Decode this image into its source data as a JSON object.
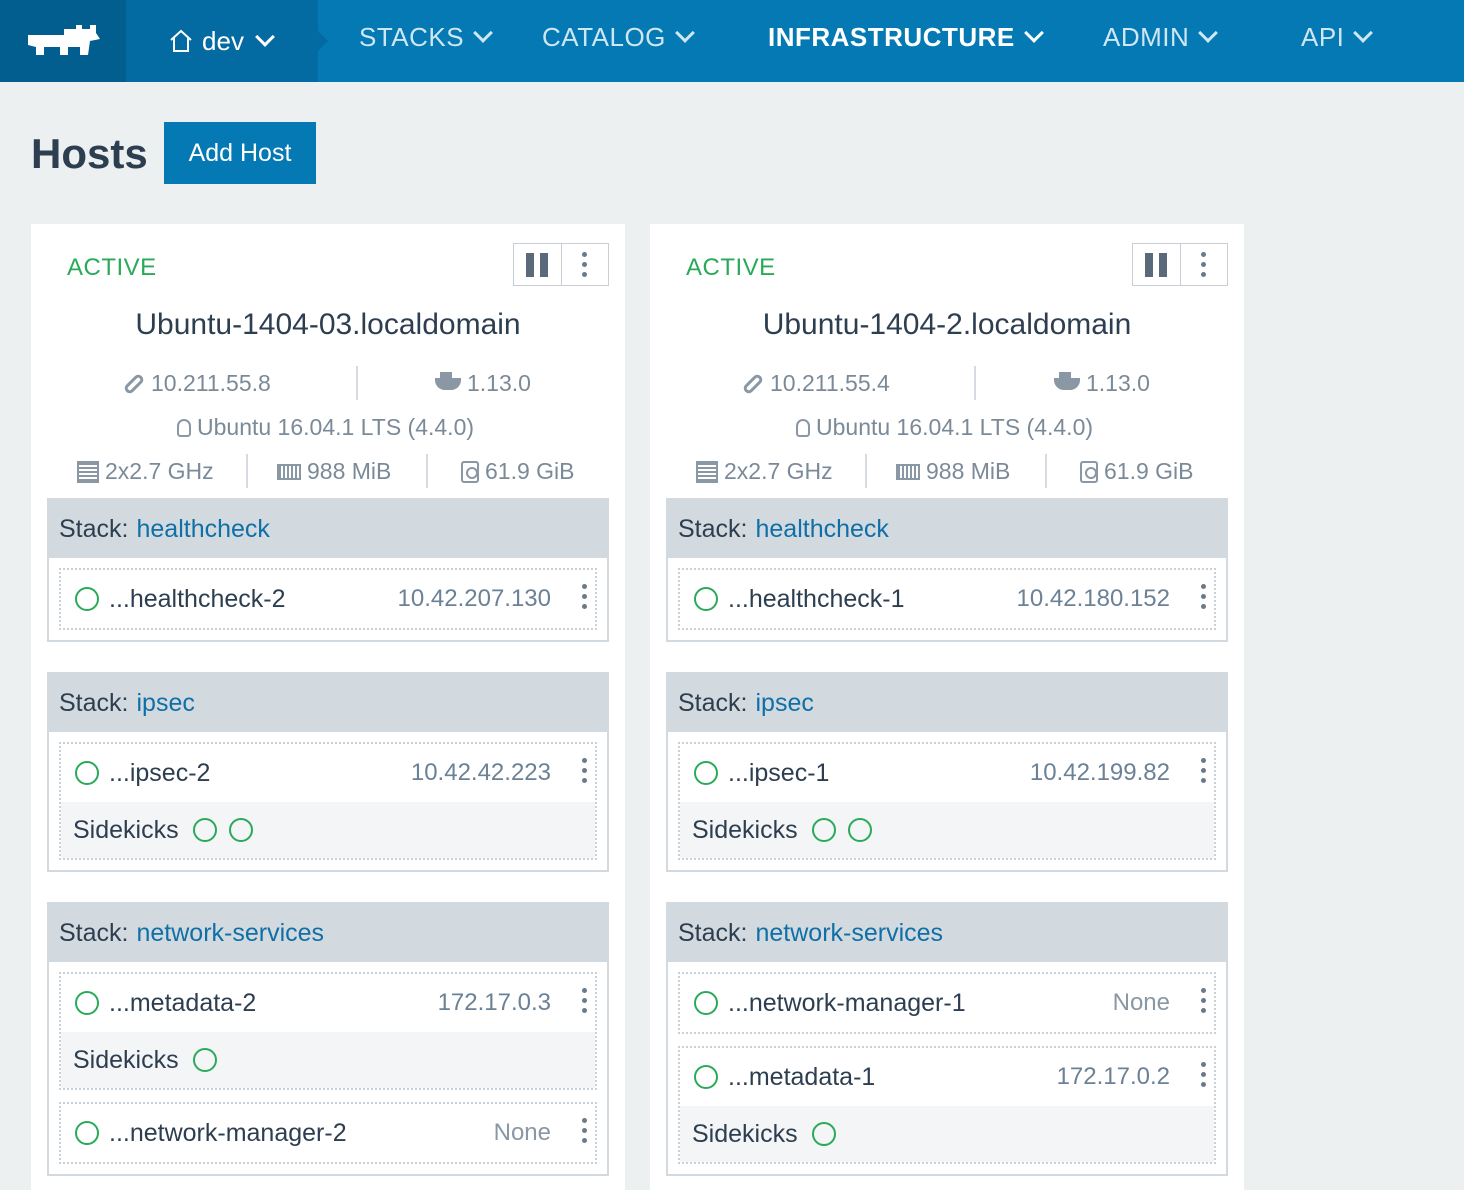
{
  "nav": {
    "env_label": "dev",
    "items": [
      {
        "label": "STACKS"
      },
      {
        "label": "CATALOG"
      },
      {
        "label": "INFRASTRUCTURE"
      },
      {
        "label": "ADMIN"
      },
      {
        "label": "API"
      }
    ],
    "active_item": "INFRASTRUCTURE"
  },
  "page": {
    "title": "Hosts",
    "add_host_label": "Add Host"
  },
  "hosts": [
    {
      "state": "ACTIVE",
      "name": "Ubuntu-1404-03.localdomain",
      "ip": "10.211.55.8",
      "docker_version": "1.13.0",
      "os": "Ubuntu 16.04.1 LTS (4.4.0)",
      "cpu": "2x2.7 GHz",
      "memory": "988 MiB",
      "storage": "61.9 GiB",
      "stacks": [
        {
          "prefix": "Stack:",
          "name": "healthcheck",
          "instances": [
            {
              "name": "...healthcheck-2",
              "ip": "10.42.207.130"
            }
          ]
        },
        {
          "prefix": "Stack:",
          "name": "ipsec",
          "instances": [
            {
              "name": "...ipsec-2",
              "ip": "10.42.42.223",
              "sidekicks_label": "Sidekicks"
            }
          ]
        },
        {
          "prefix": "Stack:",
          "name": "network-services",
          "instances": [
            {
              "name": "...metadata-2",
              "ip": "172.17.0.3",
              "sidekicks_label": "Sidekicks"
            },
            {
              "name": "...network-manager-2",
              "ip": "None"
            }
          ]
        }
      ]
    },
    {
      "state": "ACTIVE",
      "name": "Ubuntu-1404-2.localdomain",
      "ip": "10.211.55.4",
      "docker_version": "1.13.0",
      "os": "Ubuntu 16.04.1 LTS (4.4.0)",
      "cpu": "2x2.7 GHz",
      "memory": "988 MiB",
      "storage": "61.9 GiB",
      "stacks": [
        {
          "prefix": "Stack:",
          "name": "healthcheck",
          "instances": [
            {
              "name": "...healthcheck-1",
              "ip": "10.42.180.152"
            }
          ]
        },
        {
          "prefix": "Stack:",
          "name": "ipsec",
          "instances": [
            {
              "name": "...ipsec-1",
              "ip": "10.42.199.82",
              "sidekicks_label": "Sidekicks"
            }
          ]
        },
        {
          "prefix": "Stack:",
          "name": "network-services",
          "instances": [
            {
              "name": "...network-manager-1",
              "ip": "None"
            },
            {
              "name": "...metadata-1",
              "ip": "172.17.0.2",
              "sidekicks_label": "Sidekicks"
            }
          ]
        }
      ]
    }
  ],
  "colors": {
    "nav_bg": "#0479b3",
    "logo_bg": "#025e8e",
    "env_bg": "#036ba1",
    "active_state": "#2aaa59",
    "stack_link": "#0f6fa6"
  }
}
